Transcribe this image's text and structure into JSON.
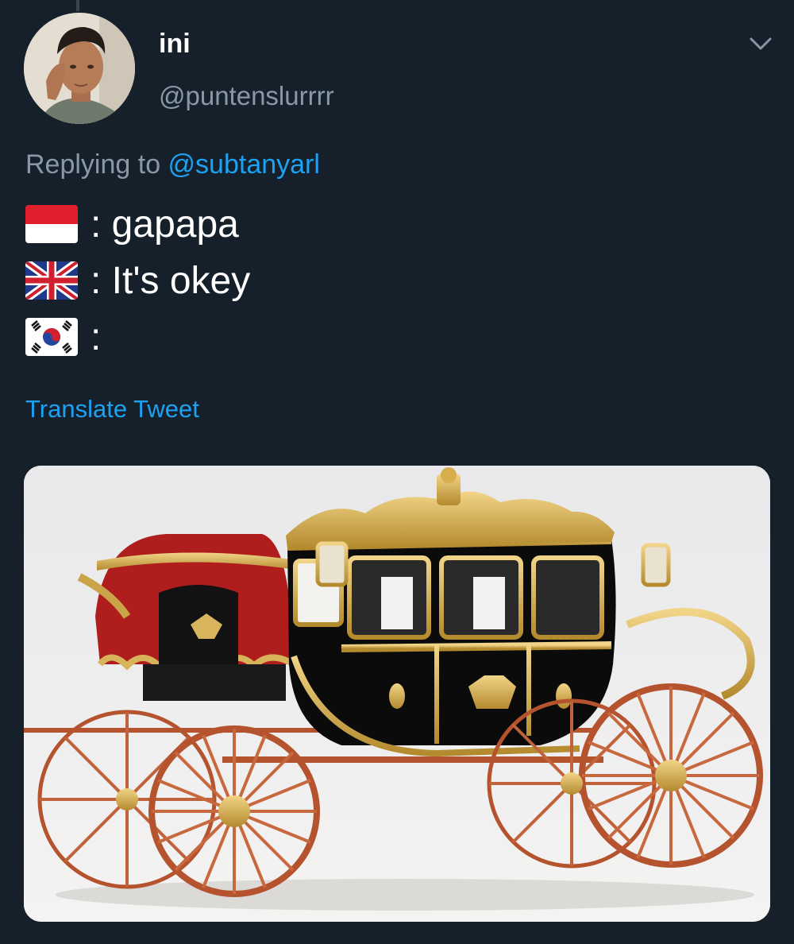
{
  "tweet": {
    "display_name": "ini",
    "handle": "@puntenslurrrr",
    "replying_prefix": "Replying to ",
    "replying_to": "@subtanyarl",
    "lines": [
      {
        "flag": "indonesia-flag-icon",
        "text": ": gapapa"
      },
      {
        "flag": "uk-flag-icon",
        "text": ": It's okey"
      },
      {
        "flag": "south-korea-flag-icon",
        "text": ":"
      }
    ],
    "translate_label": "Translate Tweet",
    "media_icon": "golden-carriage-photo"
  },
  "colors": {
    "background": "#15202b",
    "text": "#ffffff",
    "secondary_text": "#8899a6",
    "link": "#1da1f2"
  }
}
